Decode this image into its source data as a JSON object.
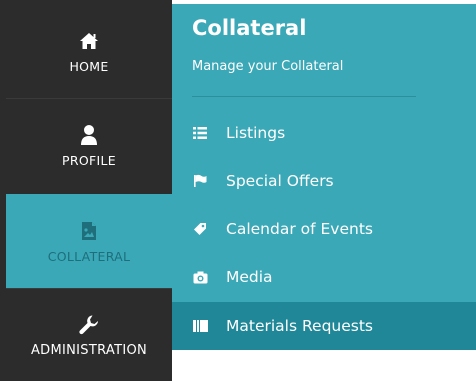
{
  "nav": {
    "items": [
      {
        "label": "HOME",
        "icon": "home-icon"
      },
      {
        "label": "PROFILE",
        "icon": "user-icon"
      },
      {
        "label": "COLLATERAL",
        "icon": "image-file-icon",
        "active": true
      },
      {
        "label": "ADMINISTRATION",
        "icon": "wrench-icon"
      }
    ]
  },
  "panel": {
    "title": "Collateral",
    "subtitle": "Manage your Collateral",
    "menu": [
      {
        "label": "Listings",
        "icon": "list-icon"
      },
      {
        "label": "Special Offers",
        "icon": "flag-icon"
      },
      {
        "label": "Calendar of Events",
        "icon": "tag-icon"
      },
      {
        "label": "Media",
        "icon": "camera-icon"
      },
      {
        "label": "Materials Requests",
        "icon": "book-icon",
        "active": true
      }
    ]
  },
  "colors": {
    "nav_bg": "#2c2c2c",
    "accent": "#3ba8b7",
    "accent_dark": "#1f8798",
    "active_label": "#1e6f7b"
  }
}
